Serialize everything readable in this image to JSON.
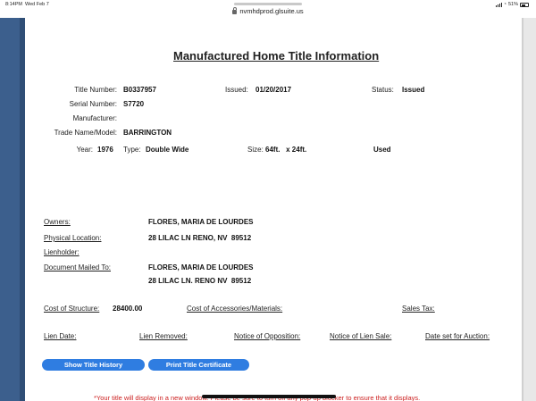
{
  "device": {
    "time": "8:14PM",
    "date": "Wed Feb 7",
    "battery": "51%"
  },
  "browser": {
    "url": "nvmhdprod.glsuite.us"
  },
  "page": {
    "title": "Manufactured Home Title Information",
    "fields": {
      "title_number_label": "Title Number:",
      "title_number": "B0337957",
      "issued_label": "Issued:",
      "issued": "01/20/2017",
      "status_label": "Status:",
      "status": "Issued",
      "serial_label": "Serial Number:",
      "serial": "S7720",
      "manufacturer_label": "Manufacturer:",
      "manufacturer": "",
      "trade_label": "Trade Name/Model:",
      "trade": "BARRINGTON",
      "year_label": "Year:",
      "year": "1976",
      "type_label": "Type:",
      "type": "Double Wide",
      "size_label": "Size:",
      "size": "64ft.   x 24ft.",
      "condition": "Used"
    },
    "parties": {
      "owners_label": "Owners:",
      "owners": "FLORES, MARIA DE LOURDES",
      "location_label": "Physical Location:",
      "location": "28 LILAC LN RENO, NV  89512",
      "lienholder_label": "Lienholder:",
      "lienholder": "",
      "mailed_label": "Document Mailed To:",
      "mailed_name": "FLORES, MARIA DE LOURDES",
      "mailed_address": "28 LILAC LN. RENO NV  89512"
    },
    "costs": {
      "structure_label": "Cost of Structure:",
      "structure": "28400.00",
      "accessories_label": "Cost of Accessories/Materials:",
      "sales_tax_label": "Sales Tax:"
    },
    "liens": {
      "lien_date": "Lien Date:",
      "lien_removed": "Lien Removed:",
      "notice_opposition": "Notice of Opposition:",
      "notice_lien_sale": "Notice of Lien Sale:",
      "auction_date": "Date set for Auction:"
    },
    "buttons": {
      "history": "Show Title History",
      "certificate": "Print Title Certificate"
    },
    "note": "*Your title will display in a new window. Please be sure to turn off any pop-up blocker to ensure that it displays."
  }
}
